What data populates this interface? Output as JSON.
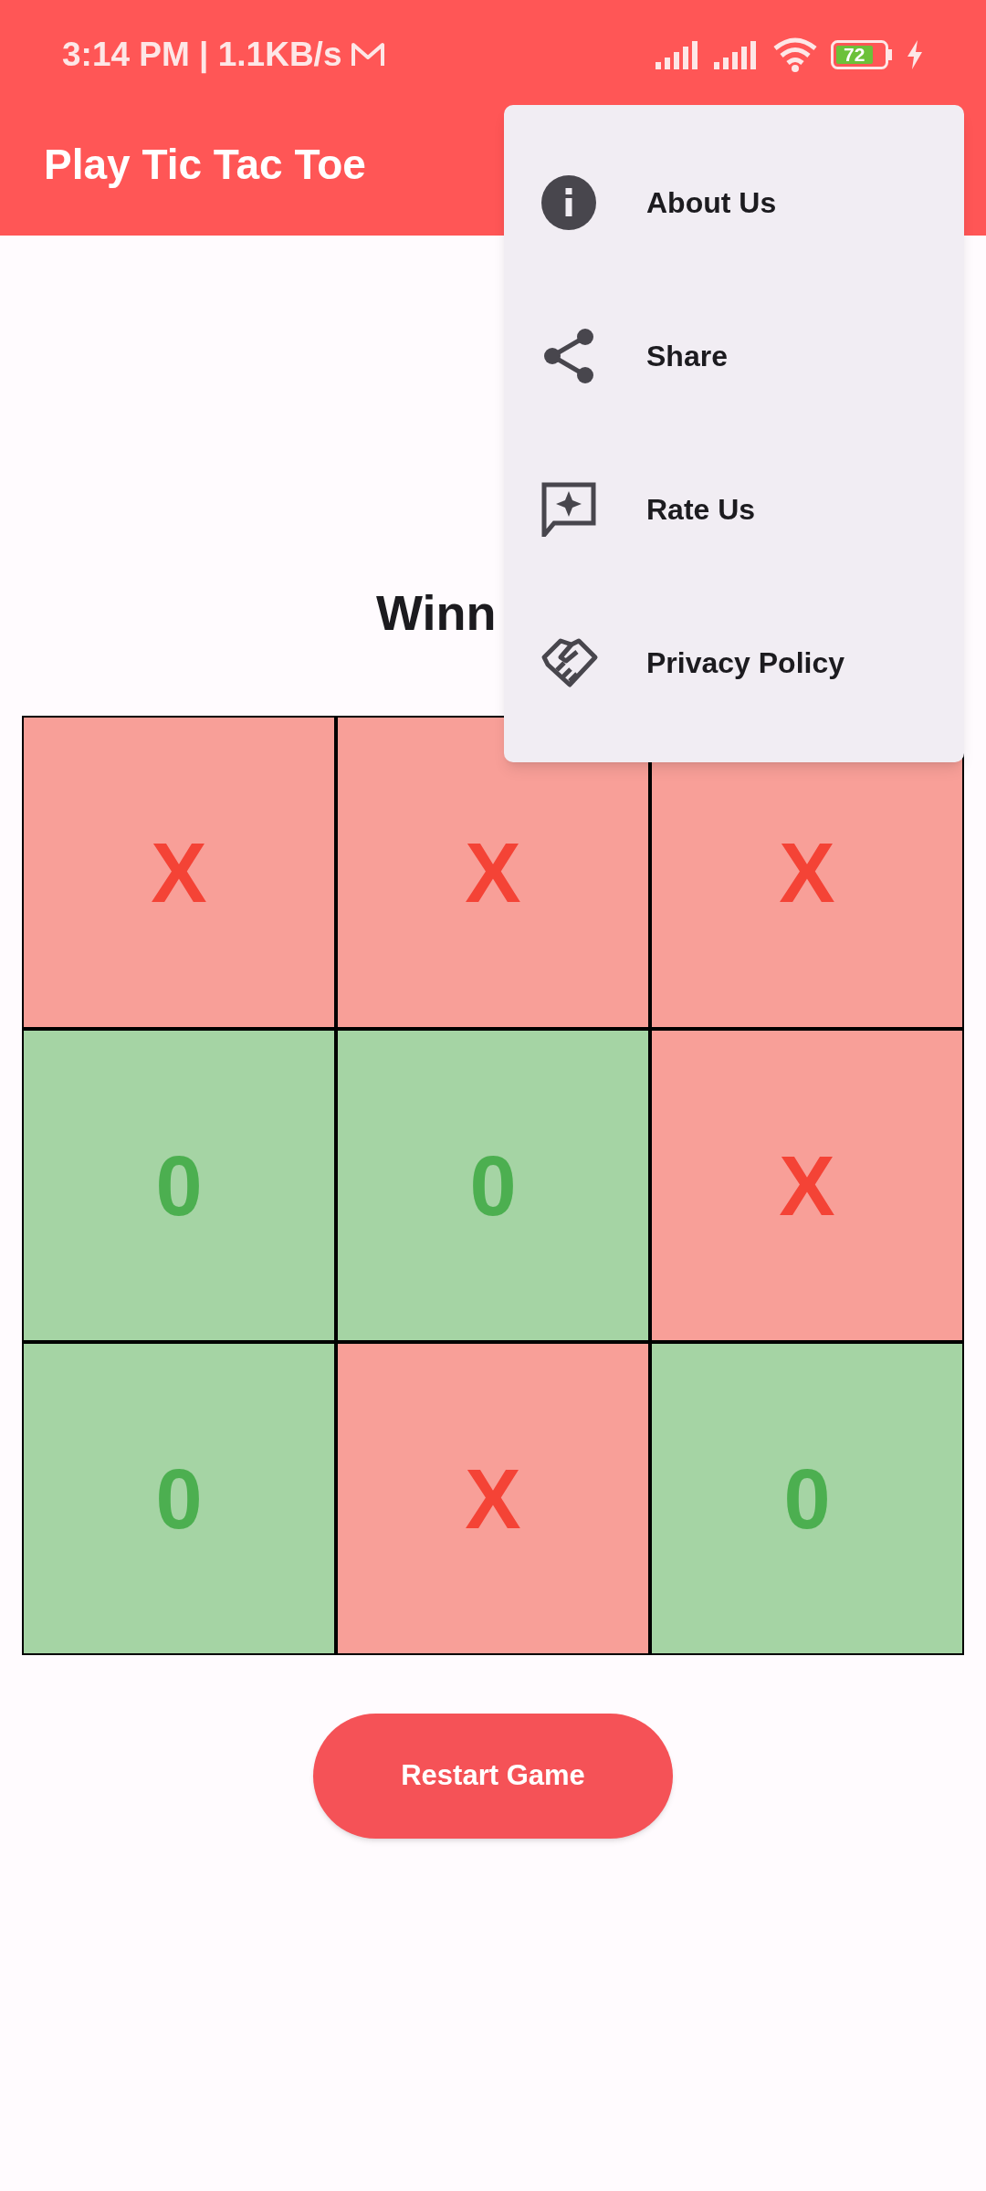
{
  "status_bar": {
    "time_speed": "3:14 PM | 1.1KB/s",
    "battery": "72"
  },
  "app_bar": {
    "title": "Play Tic Tac Toe"
  },
  "result": "Winn",
  "board": [
    {
      "kind": "x",
      "mark": "X"
    },
    {
      "kind": "x",
      "mark": "X"
    },
    {
      "kind": "x",
      "mark": "X"
    },
    {
      "kind": "o",
      "mark": "0"
    },
    {
      "kind": "o",
      "mark": "0"
    },
    {
      "kind": "x",
      "mark": "X"
    },
    {
      "kind": "o",
      "mark": "0"
    },
    {
      "kind": "x",
      "mark": "X"
    },
    {
      "kind": "o",
      "mark": "0"
    }
  ],
  "restart_button": "Restart Game",
  "menu": [
    {
      "kind": "info",
      "label": "About Us"
    },
    {
      "kind": "share",
      "label": "Share"
    },
    {
      "kind": "rate",
      "label": "Rate Us"
    },
    {
      "kind": "privacy",
      "label": "Privacy Policy"
    }
  ]
}
